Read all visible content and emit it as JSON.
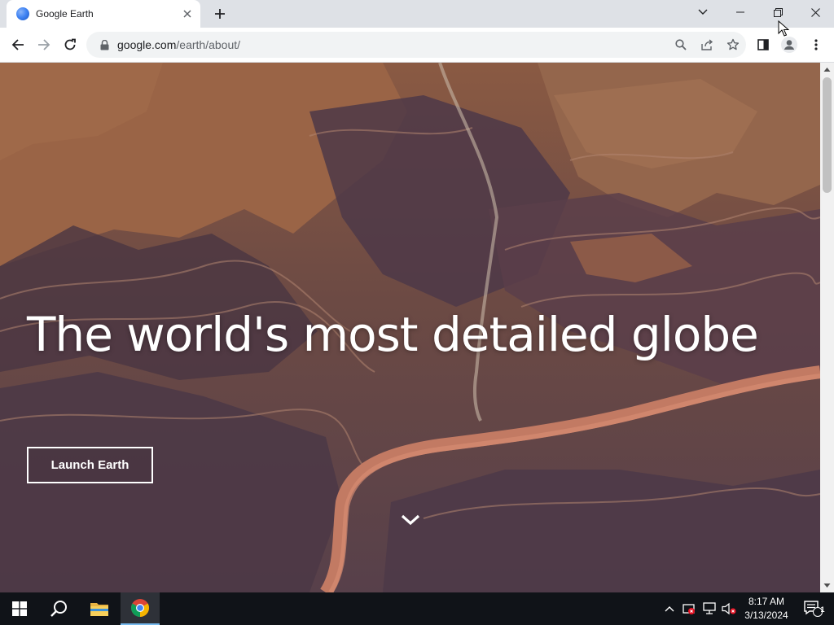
{
  "browser": {
    "tab": {
      "title": "Google Earth",
      "favicon": "earth-favicon-icon"
    },
    "new_tab_label": "+",
    "address": {
      "domain": "google.com",
      "path": "/earth/about/"
    },
    "toolbar_icons": [
      "back-icon",
      "forward-icon",
      "reload-icon",
      "lock-icon",
      "search-icon",
      "share-icon",
      "star-icon",
      "side-panel-icon",
      "profile-icon",
      "menu-icon"
    ]
  },
  "hero": {
    "title": "The world's most detailed globe",
    "button_label": "Launch Earth"
  },
  "taskbar": {
    "time": "8:17 AM",
    "date": "3/13/2024",
    "notification_count": "1",
    "apps": [
      "windows-start-icon",
      "search-icon",
      "file-explorer-icon",
      "chrome-icon"
    ]
  },
  "colors": {
    "tab_strip": "#dee1e6",
    "taskbar": "#101318",
    "accent_blue": "#4285f4"
  }
}
